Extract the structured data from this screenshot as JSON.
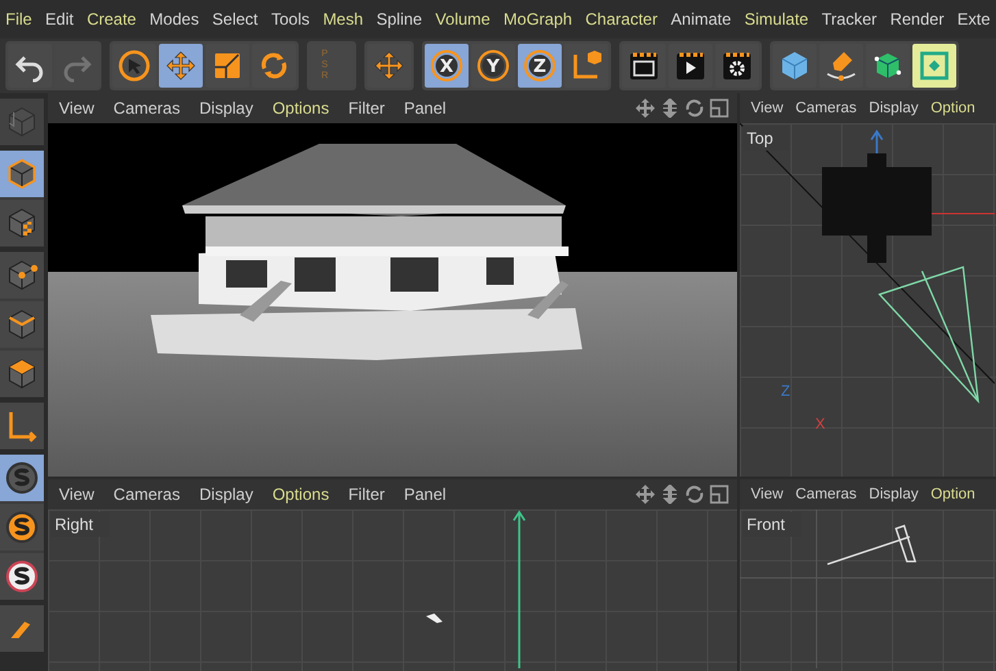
{
  "menu": [
    {
      "label": "File",
      "accent": true
    },
    {
      "label": "Edit",
      "accent": false
    },
    {
      "label": "Create",
      "accent": true
    },
    {
      "label": "Modes",
      "accent": false
    },
    {
      "label": "Select",
      "accent": false
    },
    {
      "label": "Tools",
      "accent": false
    },
    {
      "label": "Mesh",
      "accent": true
    },
    {
      "label": "Spline",
      "accent": false
    },
    {
      "label": "Volume",
      "accent": true
    },
    {
      "label": "MoGraph",
      "accent": true
    },
    {
      "label": "Character",
      "accent": true
    },
    {
      "label": "Animate",
      "accent": false
    },
    {
      "label": "Simulate",
      "accent": true
    },
    {
      "label": "Tracker",
      "accent": false
    },
    {
      "label": "Render",
      "accent": false
    },
    {
      "label": "Exte",
      "accent": false
    }
  ],
  "toolbar": [
    [
      {
        "kind": "undo",
        "selected": false,
        "disabled": false
      },
      {
        "kind": "redo",
        "selected": false,
        "disabled": true
      }
    ],
    [
      {
        "kind": "select",
        "selected": false,
        "disabled": false
      },
      {
        "kind": "move",
        "selected": true,
        "disabled": false
      },
      {
        "kind": "scale",
        "selected": false,
        "disabled": false
      },
      {
        "kind": "rotate",
        "selected": false,
        "disabled": false
      }
    ],
    [
      {
        "kind": "psr",
        "selected": false,
        "disabled": true,
        "letters": [
          "P",
          "S",
          "R"
        ]
      }
    ],
    [
      {
        "kind": "move",
        "selected": false,
        "disabled": false
      }
    ],
    [
      {
        "kind": "axis",
        "label": "X",
        "selected": true,
        "disabled": false
      },
      {
        "kind": "axis",
        "label": "Y",
        "selected": false,
        "disabled": false
      },
      {
        "kind": "axis",
        "label": "Z",
        "selected": true,
        "disabled": false
      },
      {
        "kind": "coords",
        "selected": false,
        "disabled": false
      }
    ],
    [
      {
        "kind": "render-view",
        "selected": false,
        "disabled": false
      },
      {
        "kind": "render",
        "selected": false,
        "disabled": false
      },
      {
        "kind": "render-settings",
        "selected": false,
        "disabled": false
      }
    ],
    [
      {
        "kind": "cube",
        "selected": false,
        "disabled": false
      },
      {
        "kind": "pen",
        "selected": false,
        "disabled": false
      },
      {
        "kind": "subdivision",
        "selected": false,
        "disabled": false
      },
      {
        "kind": "deformer",
        "selected": true,
        "disabled": false
      }
    ]
  ],
  "sidebar": [
    [
      {
        "kind": "make-editable",
        "selected": false,
        "disabled": true
      }
    ],
    [
      {
        "kind": "model",
        "selected": true,
        "disabled": false
      },
      {
        "kind": "texture",
        "selected": false,
        "disabled": false
      }
    ],
    [
      {
        "kind": "points",
        "selected": false,
        "disabled": false
      },
      {
        "kind": "edges",
        "selected": false,
        "disabled": false
      },
      {
        "kind": "polygons",
        "selected": false,
        "disabled": false
      }
    ],
    [
      {
        "kind": "axis",
        "selected": false,
        "disabled": false
      }
    ],
    [
      {
        "kind": "snap",
        "selected": true,
        "disabled": false
      },
      {
        "kind": "snap-orange",
        "selected": false,
        "disabled": false
      },
      {
        "kind": "snap-white",
        "selected": false,
        "disabled": false
      }
    ],
    [
      {
        "kind": "brush",
        "selected": false,
        "disabled": false
      }
    ]
  ],
  "viewports": [
    {
      "kind": "perspective",
      "nav_icons": true,
      "menu": [
        {
          "label": "View",
          "accent": false
        },
        {
          "label": "Cameras",
          "accent": false
        },
        {
          "label": "Display",
          "accent": false
        },
        {
          "label": "Options",
          "accent": true
        },
        {
          "label": "Filter",
          "accent": false
        },
        {
          "label": "Panel",
          "accent": false
        }
      ]
    },
    {
      "kind": "top",
      "name": "Top",
      "nav_icons": false,
      "gizmo": [
        "Z",
        "X"
      ],
      "menu": [
        {
          "label": "View",
          "accent": false
        },
        {
          "label": "Cameras",
          "accent": false
        },
        {
          "label": "Display",
          "accent": false
        },
        {
          "label": "Option",
          "accent": true
        }
      ]
    },
    {
      "kind": "right",
      "name": "Right",
      "nav_icons": true,
      "menu": [
        {
          "label": "View",
          "accent": false
        },
        {
          "label": "Cameras",
          "accent": false
        },
        {
          "label": "Display",
          "accent": false
        },
        {
          "label": "Options",
          "accent": true
        },
        {
          "label": "Filter",
          "accent": false
        },
        {
          "label": "Panel",
          "accent": false
        }
      ]
    },
    {
      "kind": "front",
      "name": "Front",
      "nav_icons": false,
      "menu": [
        {
          "label": "View",
          "accent": false
        },
        {
          "label": "Cameras",
          "accent": false
        },
        {
          "label": "Display",
          "accent": false
        },
        {
          "label": "Option",
          "accent": true
        }
      ]
    }
  ]
}
